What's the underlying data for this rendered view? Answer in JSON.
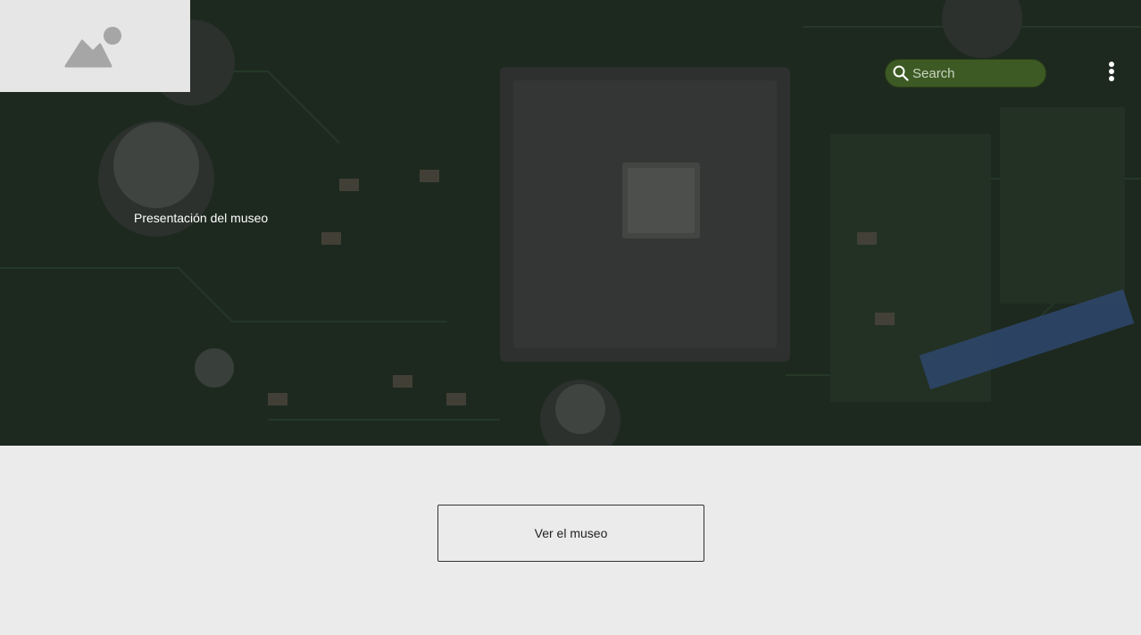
{
  "header": {
    "logo_icon": "image-placeholder-icon",
    "search": {
      "placeholder": "Search",
      "value": "",
      "icon": "search-icon"
    },
    "menu_icon": "more-vertical-icon"
  },
  "hero": {
    "title": "Presentación del museo",
    "background_image": "circuit-board-photo"
  },
  "main": {
    "cta_label": "Ver el museo"
  },
  "colors": {
    "search_bg": "#3d5a24",
    "page_bg": "#ebebeb",
    "logo_bg": "#e6e6e6"
  }
}
